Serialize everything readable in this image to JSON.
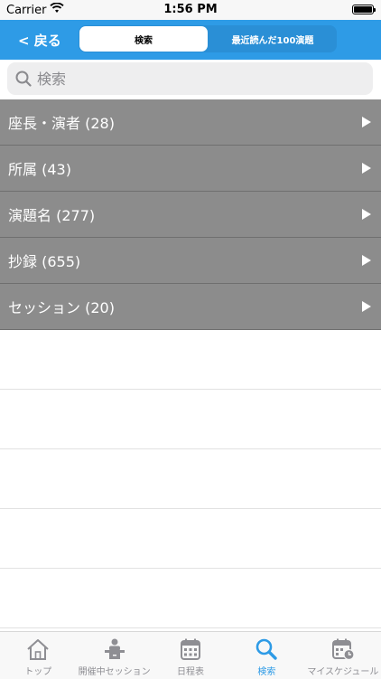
{
  "status_bar": {
    "carrier": "Carrier",
    "time": "1:56 PM"
  },
  "nav": {
    "back_label": "< 戻る",
    "segments": [
      {
        "label": "検索",
        "active": true
      },
      {
        "label": "最近読んだ100演題",
        "active": false
      }
    ]
  },
  "search": {
    "placeholder": "検索"
  },
  "categories": [
    {
      "label": "座長・演者 (28)"
    },
    {
      "label": "所属 (43)"
    },
    {
      "label": "演題名 (277)"
    },
    {
      "label": "抄録 (655)"
    },
    {
      "label": "セッション (20)"
    }
  ],
  "tabs": [
    {
      "label": "トップ",
      "icon": "home-icon"
    },
    {
      "label": "開催中セッション",
      "icon": "presenter-icon"
    },
    {
      "label": "日程表",
      "icon": "calendar-icon"
    },
    {
      "label": "検索",
      "icon": "search-icon",
      "active": true
    },
    {
      "label": "マイスケジュール",
      "icon": "calendar-clock-icon"
    }
  ],
  "colors": {
    "accent": "#2e9be6",
    "row_bg": "#8c8c8c",
    "inactive_tab": "#8e8e93"
  }
}
